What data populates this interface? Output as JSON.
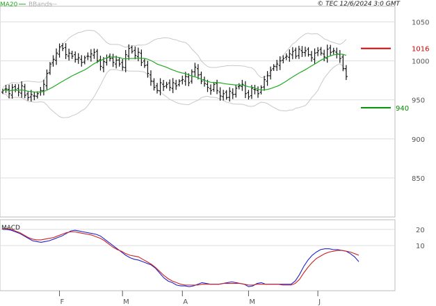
{
  "header": {
    "ma_label": "MA20",
    "bbands_label": "BBands",
    "source": "© TEC 12/6/2024 3:0 GMT"
  },
  "macd_title": "MACD",
  "colors": {
    "ma": "#22aa22",
    "bbands": "#c8c8c8",
    "bars": "#111111",
    "macd": "#2222cc",
    "signal": "#cc2222",
    "resistance": "#cc0000",
    "support": "#008800",
    "grid": "#dddddd"
  },
  "chart_data": [
    {
      "type": "ohlc",
      "name": "price",
      "ylim": [
        800,
        1070
      ],
      "yticks": [
        850,
        900,
        950,
        1000,
        1050
      ],
      "xlim": [
        0,
        113
      ],
      "xticks": [
        {
          "label": "F",
          "x": 18
        },
        {
          "label": "M",
          "x": 38
        },
        {
          "label": "A",
          "x": 57
        },
        {
          "label": "M",
          "x": 78
        },
        {
          "label": "J",
          "x": 100
        }
      ],
      "levels": [
        {
          "label": "1016",
          "value": 1016,
          "color": "#cc0000"
        },
        {
          "label": "940",
          "value": 940,
          "color": "#008800"
        }
      ],
      "close": [
        962,
        964,
        958,
        966,
        963,
        960,
        968,
        956,
        953,
        957,
        955,
        958,
        962,
        970,
        984,
        996,
        1002,
        1010,
        1018,
        1016,
        1008,
        1010,
        1006,
        1002,
        1004,
        998,
        1004,
        1006,
        1009,
        1011,
        1000,
        993,
        999,
        1004,
        1003,
        998,
        1001,
        996,
        992,
        1008,
        1016,
        1012,
        1007,
        1011,
        998,
        994,
        984,
        974,
        966,
        962,
        972,
        967,
        970,
        966,
        972,
        968,
        974,
        976,
        980,
        972,
        986,
        992,
        982,
        974,
        971,
        966,
        962,
        970,
        962,
        955,
        958,
        953,
        961,
        957,
        965,
        968,
        970,
        958,
        954,
        965,
        963,
        958,
        966,
        976,
        981,
        988,
        993,
        996,
        1000,
        1003,
        1006,
        1009,
        1012,
        1006,
        1015,
        1011,
        1013,
        1008,
        1004,
        1010,
        1013,
        1010,
        1005,
        1015,
        1011,
        1013,
        1009,
        1003,
        990,
        980
      ]
    },
    {
      "type": "line",
      "name": "macd",
      "ylim": [
        -18,
        26
      ],
      "yticks": [
        10,
        20
      ],
      "series": [
        {
          "name": "MACD",
          "values": [
            20,
            20,
            19.5,
            18.5,
            17.5,
            16,
            14.5,
            13,
            12.5,
            12,
            12.5,
            13,
            14,
            15,
            16,
            17.5,
            19,
            19.5,
            19,
            18.5,
            18,
            17.5,
            17,
            16,
            14,
            12,
            10,
            8,
            6,
            4,
            2.5,
            1.5,
            1,
            0,
            -1,
            -2,
            -4,
            -7,
            -10,
            -12,
            -13,
            -14.5,
            -15,
            -15,
            -15.5,
            -15,
            -14,
            -13,
            -13.5,
            -14,
            -14,
            -14,
            -13.5,
            -13,
            -12.5,
            -13,
            -13.5,
            -14,
            -15.5,
            -15,
            -13.5,
            -13,
            -14,
            -14,
            -14,
            -14,
            -14,
            -14,
            -14,
            -12,
            -8,
            -3,
            1,
            4,
            6,
            7.5,
            8,
            8,
            7.5,
            7.5,
            7,
            6.5,
            5,
            3,
            0
          ]
        },
        {
          "name": "Signal",
          "values": [
            20.5,
            20.5,
            20,
            19,
            18,
            16.5,
            15,
            14,
            13.5,
            13.5,
            14,
            14.5,
            15,
            16,
            17,
            18,
            18.5,
            18.5,
            18,
            17.5,
            17,
            16.5,
            15.5,
            14.5,
            13,
            11,
            9,
            7.5,
            6.5,
            5,
            4,
            3.5,
            3,
            1.5,
            0,
            -1.5,
            -3.5,
            -6,
            -8.5,
            -10.5,
            -12,
            -13,
            -14,
            -14.5,
            -14.5,
            -14.5,
            -14.5,
            -14,
            -14,
            -14,
            -14,
            -14,
            -13.5,
            -13.5,
            -13.5,
            -13.5,
            -13.5,
            -14,
            -14.5,
            -14.5,
            -14,
            -14,
            -14,
            -14,
            -14,
            -14,
            -14.5,
            -14.5,
            -14.5,
            -13.5,
            -11,
            -7,
            -3.5,
            -0.5,
            2,
            3.5,
            5,
            6,
            6.5,
            7,
            7,
            6.5,
            6,
            5,
            4
          ]
        }
      ]
    }
  ]
}
